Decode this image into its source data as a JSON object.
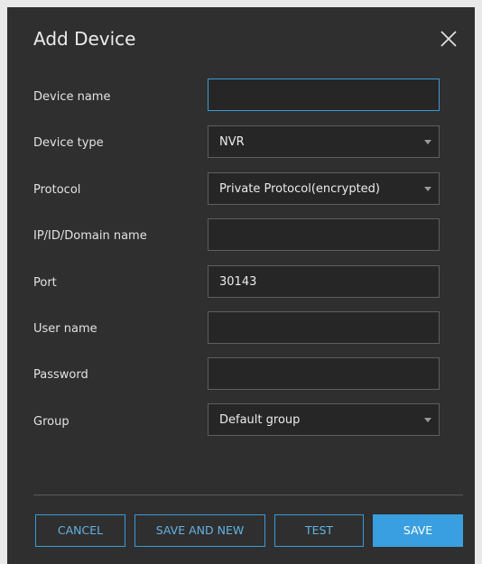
{
  "dialog": {
    "title": "Add Device",
    "close_icon": "close-icon"
  },
  "form": {
    "device_name": {
      "label": "Device name",
      "value": ""
    },
    "device_type": {
      "label": "Device type",
      "value": "NVR"
    },
    "protocol": {
      "label": "Protocol",
      "value": "Private Protocol(encrypted)"
    },
    "ip": {
      "label": "IP/ID/Domain name",
      "value": ""
    },
    "port": {
      "label": "Port",
      "value": "30143"
    },
    "username": {
      "label": "User name",
      "value": ""
    },
    "password": {
      "label": "Password",
      "value": ""
    },
    "group": {
      "label": "Group",
      "value": "Default group"
    }
  },
  "buttons": {
    "cancel": "CANCEL",
    "save_and_new": "SAVE AND NEW",
    "test": "TEST",
    "save": "SAVE"
  },
  "colors": {
    "accent": "#3a9fe0",
    "background": "#2f2f2f",
    "field_background": "#262626"
  }
}
